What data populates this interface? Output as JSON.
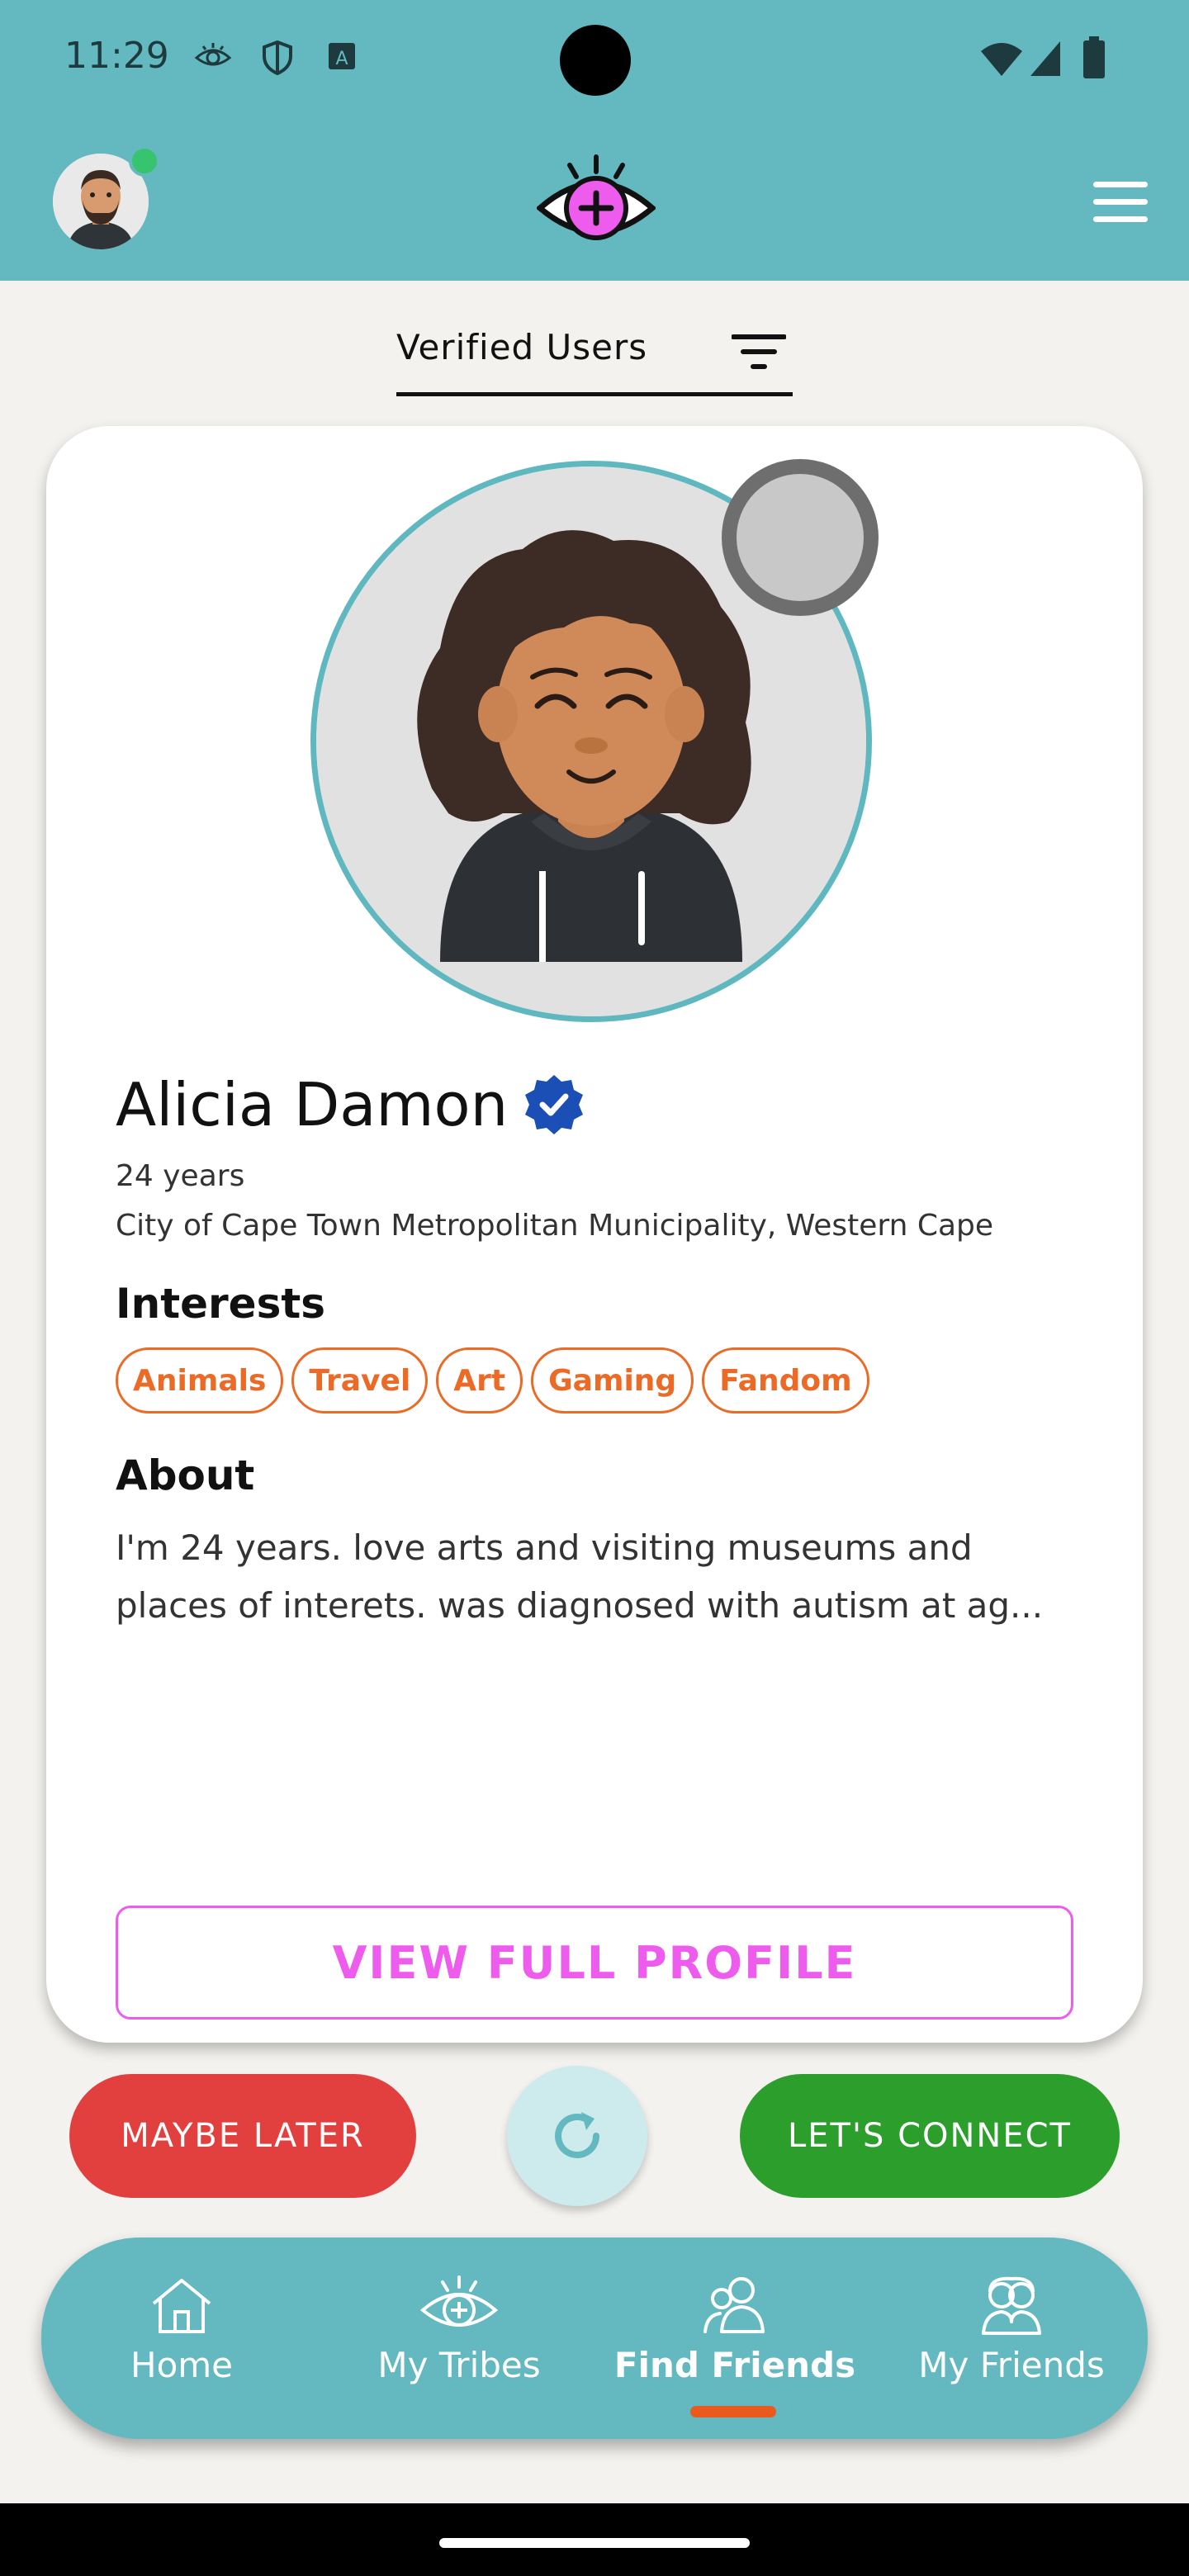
{
  "status_bar": {
    "time": "11:29",
    "icons": [
      "eye-notification-icon",
      "shield-icon",
      "a-box-icon",
      "wifi-icon",
      "signal-icon",
      "battery-icon"
    ]
  },
  "header": {
    "logo_icon": "eye-plus-logo-icon",
    "menu_icon": "hamburger-menu-icon",
    "avatar_online": true
  },
  "tabs": {
    "active_label": "Verified Users",
    "filter_icon": "filter-icon"
  },
  "profile": {
    "name": "Alicia Damon",
    "verified": true,
    "age": "24 years",
    "location": "City of Cape Town Metropolitan Municipality, Western Cape",
    "interests_title": "Interests",
    "interests": [
      "Animals",
      "Travel",
      "Art",
      "Gaming",
      "Fandom"
    ],
    "about_title": "About",
    "about_text": "I'm 24 years. love arts and visiting museums and places of interets. was diagnosed with autism at ag...",
    "view_profile_label": "VIEW FULL PROFILE"
  },
  "actions": {
    "maybe_later": "MAYBE LATER",
    "refresh_icon": "refresh-icon",
    "lets_connect": "LET'S CONNECT"
  },
  "bottom_nav": {
    "items": [
      {
        "label": "Home",
        "icon": "home-icon",
        "active": false
      },
      {
        "label": "My Tribes",
        "icon": "eye-plus-icon",
        "active": false
      },
      {
        "label": "Find Friends",
        "icon": "users-icon",
        "active": true
      },
      {
        "label": "My Friends",
        "icon": "friends-group-icon",
        "active": false
      }
    ]
  },
  "colors": {
    "header": "#63b9bf",
    "accent_pink": "#ee5cee",
    "chip_orange": "#ea6a26",
    "maybe_red": "#e2403f",
    "connect_green": "#2b9e2c",
    "indicator_orange": "#ea5a1f",
    "verified_blue": "#1b4fb5"
  }
}
